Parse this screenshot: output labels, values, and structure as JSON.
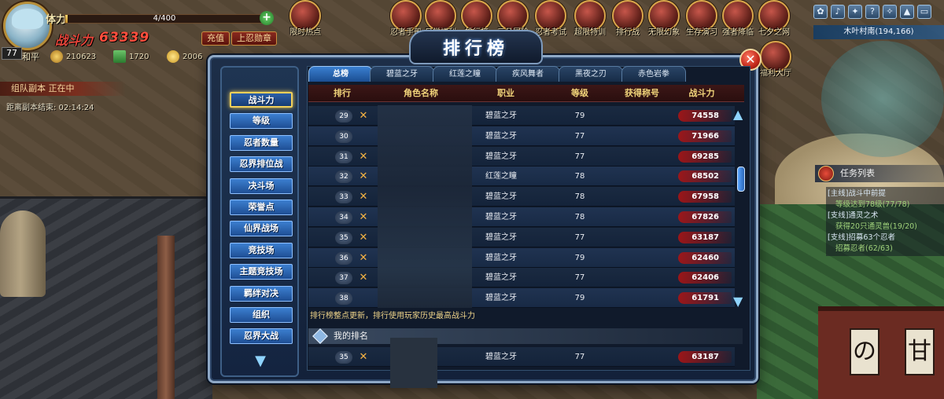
{
  "hud": {
    "hp_label": "体力",
    "hp_value": "4/400",
    "hp_fill": 0.01,
    "power_label": "战斗力",
    "power_value": "63339",
    "btn_recharge": "充值",
    "btn_vip": "上忍勋章",
    "player_name": "和平",
    "level": "77",
    "currency_1": "210623",
    "currency_2": "1720",
    "currency_3": "2006",
    "left_task_title": "组队副本 正在中",
    "left_task_sub": "距离副本结束: 02:14:24"
  },
  "top_icons": [
    {
      "label": "限时热点"
    },
    {
      "label": "忍者手册"
    },
    {
      "label": "日常福利"
    },
    {
      "label": "排行榜"
    },
    {
      "label": "元旦冒险"
    },
    {
      "label": "忍者考试"
    },
    {
      "label": "超限特训"
    },
    {
      "label": "排行战"
    },
    {
      "label": "无限幻象"
    },
    {
      "label": "生存演习"
    },
    {
      "label": "强者降临"
    },
    {
      "label": "七夕之网"
    },
    {
      "label": "福利大厅"
    }
  ],
  "mini_icons": [
    "✿",
    "♪",
    "✦",
    "?",
    "✧",
    "▲",
    "▭"
  ],
  "map": {
    "location": "木叶村南(194,166)"
  },
  "quests": {
    "title": "任务列表",
    "items": [
      {
        "main": "[主线]战斗中前提",
        "sub": "等级达到78级(77/78)"
      },
      {
        "main": "[支线]通灵之术",
        "sub": "获得20只通灵兽(19/20)"
      },
      {
        "main": "[支线]招募63个忍者",
        "sub": "招募忍者(62/63)"
      }
    ]
  },
  "dialog": {
    "title": "排行榜",
    "close": "✕"
  },
  "categories": [
    {
      "label": "战斗力",
      "active": true
    },
    {
      "label": "等级"
    },
    {
      "label": "忍者数量"
    },
    {
      "label": "忍界排位战"
    },
    {
      "label": "决斗场"
    },
    {
      "label": "荣誉点"
    },
    {
      "label": "仙界战场"
    },
    {
      "label": "竞技场"
    },
    {
      "label": "主题竞技场"
    },
    {
      "label": "羁绊对决"
    },
    {
      "label": "组织"
    },
    {
      "label": "忍界大战"
    }
  ],
  "tabs": [
    {
      "label": "总榜",
      "active": true
    },
    {
      "label": "碧蓝之牙"
    },
    {
      "label": "红莲之瞳"
    },
    {
      "label": "疾风舞者"
    },
    {
      "label": "黑夜之刃"
    },
    {
      "label": "赤色岩拳"
    }
  ],
  "columns": [
    "排行",
    "角色名称",
    "职业",
    "等级",
    "获得称号",
    "战斗力"
  ],
  "rows": [
    {
      "rank": "29",
      "icon": true,
      "job": "碧蓝之牙",
      "level": "79",
      "power": "74558"
    },
    {
      "rank": "30",
      "icon": false,
      "job": "碧蓝之牙",
      "level": "77",
      "power": "71966"
    },
    {
      "rank": "31",
      "icon": true,
      "job": "碧蓝之牙",
      "level": "77",
      "power": "69285"
    },
    {
      "rank": "32",
      "icon": true,
      "job": "红莲之瞳",
      "level": "78",
      "power": "68502"
    },
    {
      "rank": "33",
      "icon": true,
      "job": "碧蓝之牙",
      "level": "78",
      "power": "67958"
    },
    {
      "rank": "34",
      "icon": true,
      "job": "碧蓝之牙",
      "level": "78",
      "power": "67826"
    },
    {
      "rank": "35",
      "icon": true,
      "job": "碧蓝之牙",
      "level": "77",
      "power": "63187"
    },
    {
      "rank": "36",
      "icon": true,
      "job": "碧蓝之牙",
      "level": "79",
      "power": "62460"
    },
    {
      "rank": "37",
      "icon": true,
      "job": "碧蓝之牙",
      "level": "77",
      "power": "62406"
    },
    {
      "rank": "38",
      "icon": false,
      "job": "碧蓝之牙",
      "level": "79",
      "power": "61791"
    }
  ],
  "note": "排行榜整点更新，排行使用玩家历史最高战斗力",
  "my_rank": {
    "title": "我的排名",
    "rank": "35",
    "job": "碧蓝之牙",
    "level": "77",
    "power": "63187"
  },
  "colors": {
    "accent_blue": "#3c7fd0",
    "gold": "#f2d05a",
    "power_red": "#ff4e3d"
  }
}
